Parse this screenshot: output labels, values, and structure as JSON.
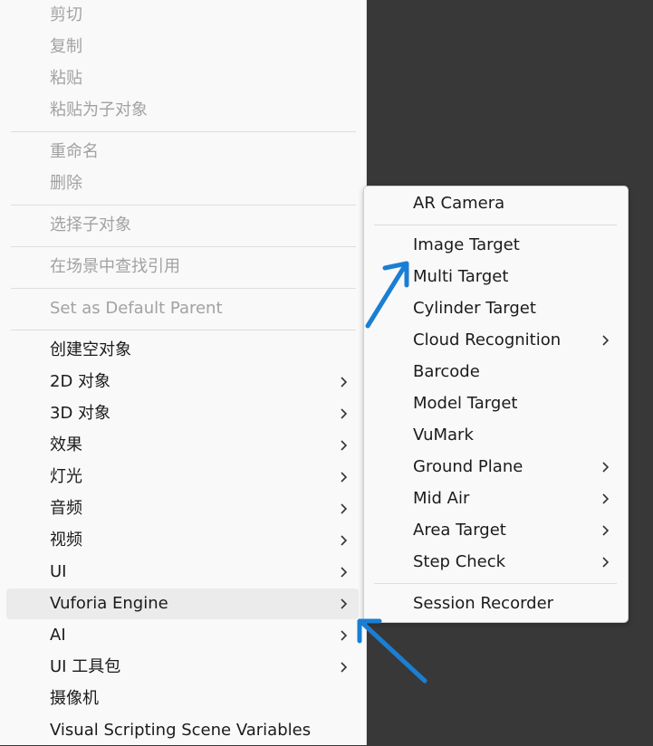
{
  "main_menu": {
    "items": [
      {
        "label": "剪切",
        "disabled": true
      },
      {
        "label": "复制",
        "disabled": true
      },
      {
        "label": "粘贴",
        "disabled": true
      },
      {
        "label": "粘贴为子对象",
        "disabled": true
      },
      {
        "label": "重命名",
        "disabled": true
      },
      {
        "label": "删除",
        "disabled": true
      },
      {
        "label": "选择子对象",
        "disabled": true
      },
      {
        "label": "在场景中查找引用",
        "disabled": true
      },
      {
        "label": "Set as Default Parent",
        "disabled": true
      },
      {
        "label": "创建空对象",
        "submenu": false
      },
      {
        "label": "2D 对象",
        "submenu": true
      },
      {
        "label": "3D 对象",
        "submenu": true
      },
      {
        "label": "效果",
        "submenu": true
      },
      {
        "label": "灯光",
        "submenu": true
      },
      {
        "label": "音频",
        "submenu": true
      },
      {
        "label": "视频",
        "submenu": true
      },
      {
        "label": "UI",
        "submenu": true
      },
      {
        "label": "Vuforia Engine",
        "submenu": true,
        "highlighted": true
      },
      {
        "label": "AI",
        "submenu": true
      },
      {
        "label": "UI 工具包",
        "submenu": true
      },
      {
        "label": "摄像机",
        "submenu": false
      },
      {
        "label": "Visual Scripting Scene Variables",
        "submenu": false
      }
    ]
  },
  "vuforia_submenu": {
    "items": [
      {
        "label": "AR Camera",
        "submenu": false
      },
      {
        "label": "Image Target",
        "submenu": false
      },
      {
        "label": "Multi Target",
        "submenu": false
      },
      {
        "label": "Cylinder Target",
        "submenu": false
      },
      {
        "label": "Cloud Recognition",
        "submenu": true
      },
      {
        "label": "Barcode",
        "submenu": false
      },
      {
        "label": "Model Target",
        "submenu": false
      },
      {
        "label": "VuMark",
        "submenu": false
      },
      {
        "label": "Ground Plane",
        "submenu": true
      },
      {
        "label": "Mid Air",
        "submenu": true
      },
      {
        "label": "Area Target",
        "submenu": true
      },
      {
        "label": "Step Check",
        "submenu": true
      },
      {
        "label": "Session Recorder",
        "submenu": false
      }
    ]
  },
  "colors": {
    "background": "#383838",
    "menu_background": "#f9f9f9",
    "text": "#1b1b1b",
    "disabled_text": "#a2a2a2",
    "highlight": "#ebebeb",
    "annotation_arrow": "#1a7fd4"
  },
  "icons": {
    "submenu_indicator": "chevron-right-icon",
    "annotation": "arrow-annotation-icon"
  }
}
